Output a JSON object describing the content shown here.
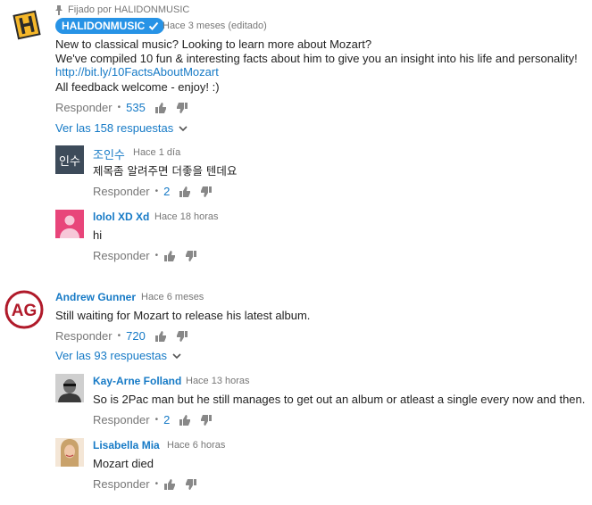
{
  "pinned_label": "Fijado por HALIDONMUSIC",
  "threads": [
    {
      "author": "HALIDONMUSIC",
      "time": "Hace 3 meses (editado)",
      "lines": [
        "New to classical music? Looking to learn more about Mozart?",
        "We've compiled 10 fun & interesting facts about him to give you an insight into his life and personality!"
      ],
      "link": "http://bit.ly/10FactsAboutMozart",
      "closing": "All feedback welcome - enjoy! :)",
      "reply_label": "Responder",
      "likes": "535",
      "view_replies": "Ver las 158 respuestas",
      "replies": [
        {
          "author": "조인수",
          "avatar_text": "인수",
          "time": "Hace 1 día",
          "text": "제목좀 알려주면 더좋을 텐데요",
          "reply_label": "Responder",
          "likes": "2"
        },
        {
          "author": "lolol XD Xd",
          "time": "Hace 18 horas",
          "text": "hi",
          "reply_label": "Responder",
          "likes": ""
        }
      ]
    },
    {
      "author": "Andrew Gunner",
      "avatar_text": "AG",
      "time": "Hace 6 meses",
      "text": "Still waiting for Mozart to release his latest album.",
      "reply_label": "Responder",
      "likes": "720",
      "view_replies": "Ver las 93 respuestas",
      "replies": [
        {
          "author": "Kay-Arne Folland",
          "time": "Hace 13 horas",
          "text": "So is 2Pac man but he still manages to get out an album or atleast a single every now and then.",
          "reply_label": "Responder",
          "likes": "2"
        },
        {
          "author": "Lisabella Mia",
          "time": "Hace 6 horas",
          "text": "Mozart died",
          "reply_label": "Responder",
          "likes": ""
        }
      ]
    }
  ],
  "colors": {
    "accent": "#167ac6",
    "badge": "#2793e6",
    "meta": "#777777"
  },
  "icons": [
    "pin-icon",
    "verified-check-icon",
    "thumbs-up-icon",
    "thumbs-down-icon",
    "chevron-down-icon"
  ]
}
